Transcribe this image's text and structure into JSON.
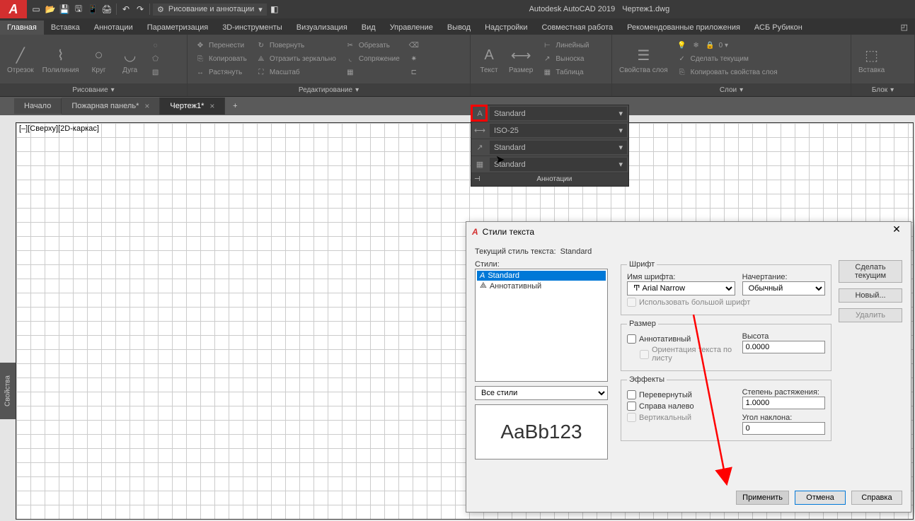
{
  "app": {
    "title": "Autodesk AutoCAD 2019",
    "doc": "Чертеж1.dwg",
    "workspace": "Рисование и аннотации"
  },
  "tabs": {
    "home": "Главная",
    "insert": "Вставка",
    "anno": "Аннотации",
    "param": "Параметризация",
    "t3d": "3D-инструменты",
    "vis": "Визуализация",
    "view": "Вид",
    "manage": "Управление",
    "output": "Вывод",
    "addins": "Надстройки",
    "collab": "Совместная работа",
    "apps": "Рекомендованные приложения",
    "asb": "АСБ Рубикон"
  },
  "ribbon": {
    "draw": {
      "title": "Рисование",
      "line": "Отрезок",
      "pline": "Полилиния",
      "circle": "Круг",
      "arc": "Дуга"
    },
    "modify": {
      "title": "Редактирование",
      "move": "Перенести",
      "rotate": "Повернуть",
      "trim": "Обрезать",
      "copy": "Копировать",
      "mirror": "Отразить зеркально",
      "fillet": "Сопряжение",
      "stretch": "Растянуть",
      "scale": "Масштаб"
    },
    "anno": {
      "text": "Текст",
      "dim": "Размер",
      "linear": "Линейный",
      "leader": "Выноска",
      "table": "Таблица"
    },
    "layers": {
      "title": "Слои",
      "props": "Свойства слоя",
      "make": "Сделать текущим",
      "copyprop": "Копировать свойства слоя"
    },
    "block": {
      "title": "Блок",
      "insert": "Вставка"
    }
  },
  "doctabs": {
    "start": "Начало",
    "t1": "Пожарная панель*",
    "t2": "Чертеж1*"
  },
  "viewport": "[–][Сверху][2D-каркас]",
  "prop_tab": "Свойства",
  "anno_panel": {
    "title": "Аннотации",
    "r1": "Standard",
    "r2": "ISO-25",
    "r3": "Standard",
    "r4": "Standard"
  },
  "dialog": {
    "title": "Стили текста",
    "current_label": "Текущий стиль текста:",
    "current": "Standard",
    "styles_label": "Стили:",
    "style1": "Standard",
    "style2": "Аннотативный",
    "font_group": "Шрифт",
    "font_name_label": "Имя шрифта:",
    "font_name": "Arial Narrow",
    "font_style_label": "Начертание:",
    "font_style": "Обычный",
    "bigfont": "Использовать большой шрифт",
    "size_group": "Размер",
    "annotative": "Аннотативный",
    "orient": "Ориентация текста по листу",
    "height_label": "Высота",
    "height": "0.0000",
    "effects_group": "Эффекты",
    "upside": "Перевернутый",
    "backwards": "Справа налево",
    "vertical": "Вертикальный",
    "widthf_label": "Степень растяжения:",
    "widthf": "1.0000",
    "oblique_label": "Угол наклона:",
    "oblique": "0",
    "preview": "AaBb123",
    "filter": "Все стили",
    "btn_current": "Сделать текущим",
    "btn_new": "Новый...",
    "btn_delete": "Удалить",
    "btn_apply": "Применить",
    "btn_cancel": "Отмена",
    "btn_help": "Справка"
  }
}
